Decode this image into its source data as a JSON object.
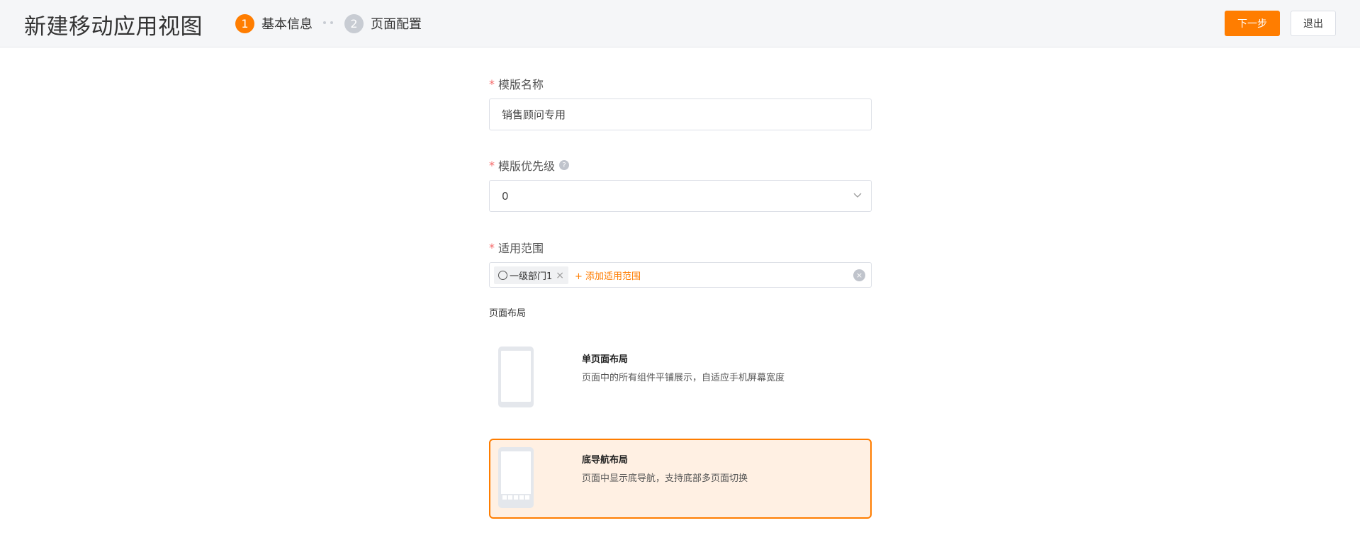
{
  "header": {
    "title": "新建移动应用视图",
    "steps": [
      {
        "number": "1",
        "label": "基本信息",
        "active": true
      },
      {
        "number": "2",
        "label": "页面配置",
        "active": false
      }
    ],
    "next_label": "下一步",
    "exit_label": "退出"
  },
  "form": {
    "template_name": {
      "label": "模版名称",
      "required_mark": "*",
      "value": "销售顾问专用"
    },
    "priority": {
      "label": "模版优先级",
      "required_mark": "*",
      "help_icon": "?",
      "value": "0"
    },
    "scope": {
      "label": "适用范围",
      "required_mark": "*",
      "tags": [
        {
          "label": "一级部门1",
          "close": "×"
        }
      ],
      "add_label": "+ 添加适用范围",
      "clear_icon": "×"
    },
    "layout": {
      "section_title": "页面布局",
      "options": [
        {
          "title": "单页面布局",
          "desc": "页面中的所有组件平铺展示，自适应手机屏幕宽度",
          "selected": false
        },
        {
          "title": "底导航布局",
          "desc": "页面中显示底导航，支持底部多页面切换",
          "selected": true
        }
      ]
    }
  },
  "colors": {
    "accent": "#ff7d00",
    "selected_bg": "#fff0e3",
    "required": "#f56c6c"
  }
}
